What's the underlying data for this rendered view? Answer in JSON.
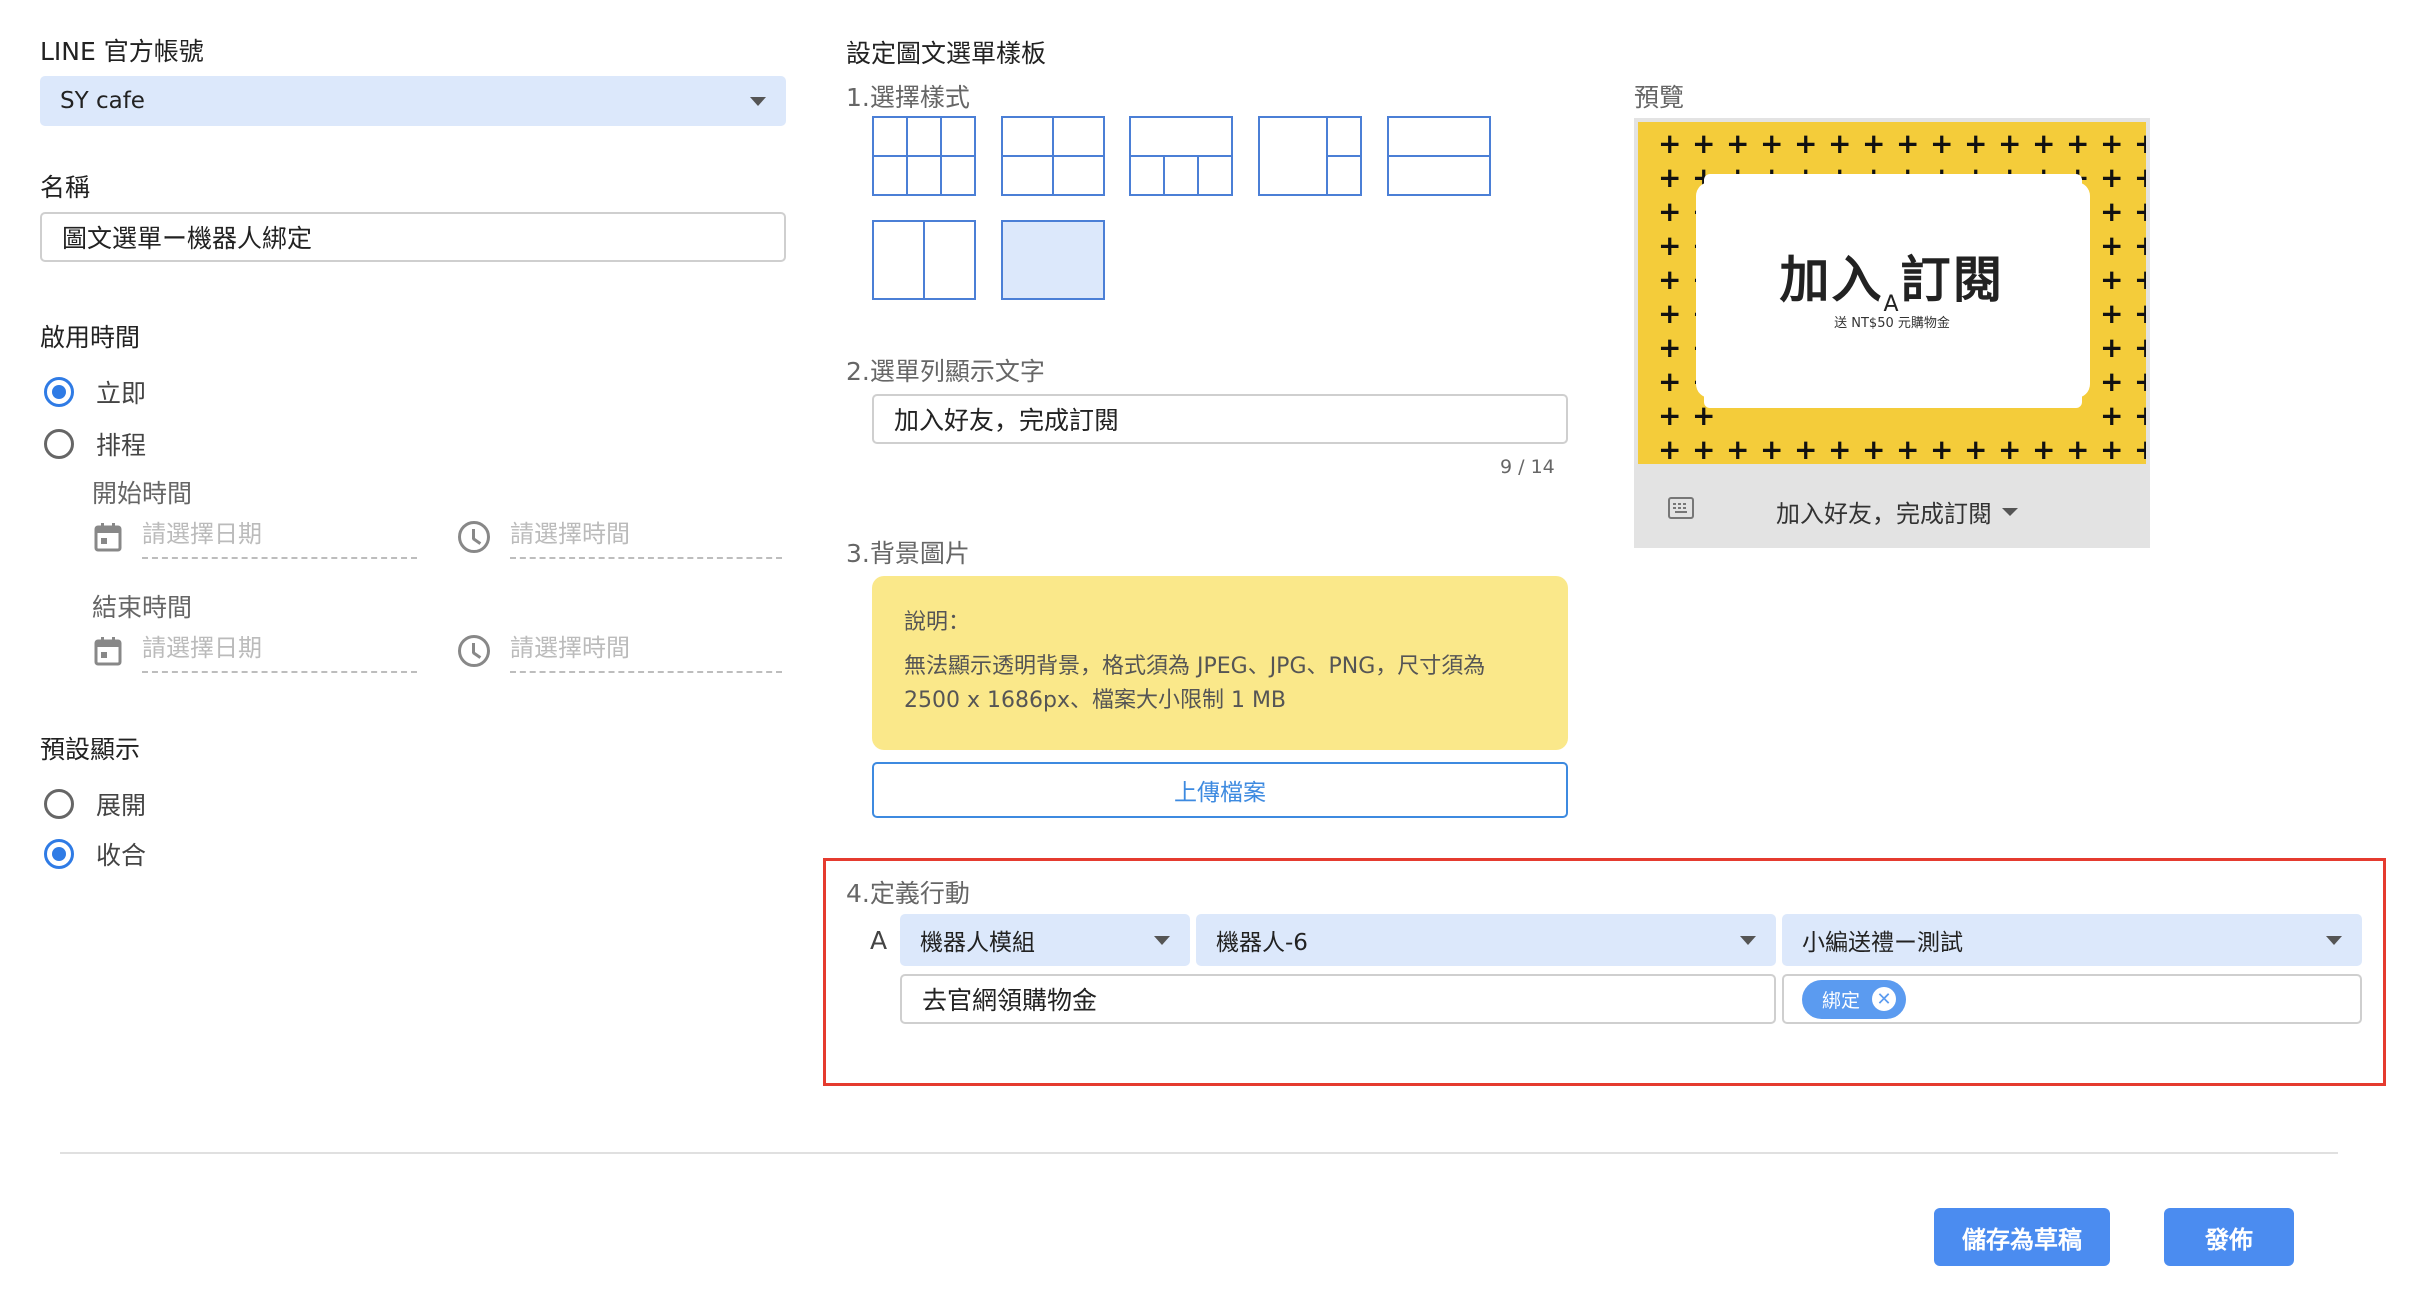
{
  "left": {
    "account_label": "LINE 官方帳號",
    "account_value": "SY cafe",
    "name_label": "名稱",
    "name_value": "圖文選單ー機器人綁定",
    "enable_time_label": "啟用時間",
    "radio_now": "立即",
    "radio_schedule": "排程",
    "start_time_label": "開始時間",
    "end_time_label": "結束時間",
    "date_placeholder": "請選擇日期",
    "time_placeholder": "請選擇時間",
    "default_display_label": "預設顯示",
    "radio_expand": "展開",
    "radio_collapse": "收合"
  },
  "template": {
    "title": "設定圖文選單樣板",
    "step1": "1.選擇樣式",
    "step2": "2.選單列顯示文字",
    "menu_text": "加入好友，完成訂閱",
    "char_count": "9 / 14",
    "step3": "3.背景圖片",
    "note_title": "說明：",
    "note_body": "無法顯示透明背景，格式須為 JPEG、JPG、PNG，尺寸須為 2500 x 1686px、檔案大小限制 1 MB",
    "upload_label": "上傳檔案",
    "step4": "4.定義行動",
    "action_letter": "A",
    "action_type": "機器人模組",
    "action_bot": "機器人-6",
    "action_flow": "小編送禮ー測試",
    "action_text": "去官網領購物金",
    "chip_label": "綁定",
    "chip_close": "✕"
  },
  "preview": {
    "label": "預覽",
    "headline_left": "加入",
    "headline_right": "訂閱",
    "area_letter": "A",
    "subline": "送 NT$50 元購物金",
    "bar_text": "加入好友，完成訂閱",
    "keyboard_icon": "keyboard-icon"
  },
  "footer": {
    "save_draft": "儲存為草稿",
    "publish": "發佈"
  },
  "colors": {
    "accent": "#4b8cf0",
    "select_bg": "#dce8fb",
    "note_bg": "#fae88a",
    "highlight_border": "#e53b2f",
    "preview_yellow": "#f4cc3a"
  }
}
